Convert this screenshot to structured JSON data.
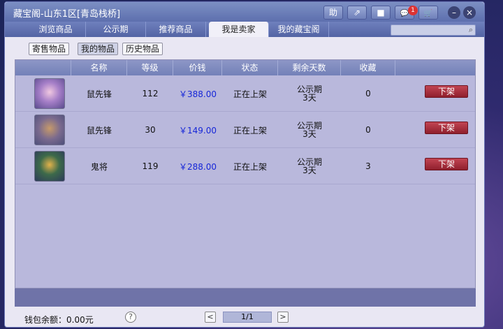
{
  "window": {
    "title": "藏宝阁-山东1区[青岛栈桥]"
  },
  "title_buttons": [
    {
      "name": "help-char-button",
      "label": "助"
    },
    {
      "name": "share-button",
      "label": "⇗"
    },
    {
      "name": "record-button",
      "label": "■"
    },
    {
      "name": "chat-button",
      "label": "💬"
    },
    {
      "name": "cart-button",
      "label": "🛒"
    }
  ],
  "chat_badge": "1",
  "tabs": [
    "浏览商品",
    "公示期",
    "推荐商品",
    "我是卖家",
    "我的藏宝阁"
  ],
  "active_tab_index": 3,
  "subtabs": [
    "寄售物品",
    "我的物品",
    "历史物品"
  ],
  "active_subtab_index": 1,
  "columns": [
    "名称",
    "等级",
    "价钱",
    "状态",
    "剩余天数",
    "收藏"
  ],
  "rows": [
    {
      "name": "鼠先锋",
      "level": "112",
      "price": "￥388.00",
      "status": "正在上架",
      "remaining_line1": "公示期",
      "remaining_line2": "3天",
      "favorites": "0",
      "action": "下架"
    },
    {
      "name": "鼠先锋",
      "level": "30",
      "price": "￥149.00",
      "status": "正在上架",
      "remaining_line1": "公示期",
      "remaining_line2": "3天",
      "favorites": "0",
      "action": "下架"
    },
    {
      "name": "鬼将",
      "level": "119",
      "price": "￥288.00",
      "status": "正在上架",
      "remaining_line1": "公示期",
      "remaining_line2": "3天",
      "favorites": "3",
      "action": "下架"
    }
  ],
  "footer": {
    "wallet_label": "钱包余额：0.00元",
    "help": "?",
    "prev": "<",
    "page": "1/1",
    "next": ">"
  },
  "colors": {
    "price": "#1626d8",
    "remove_button": "#a82a38",
    "titlebar": "#6c7fb9"
  }
}
